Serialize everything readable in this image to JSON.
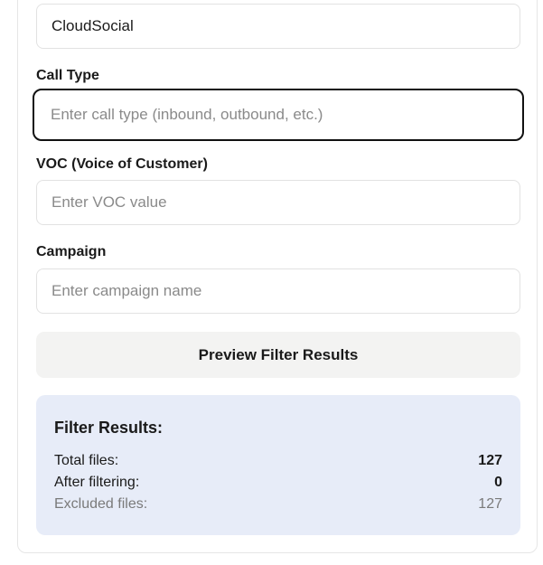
{
  "fields": {
    "source": {
      "value": "CloudSocial"
    },
    "call_type": {
      "label": "Call Type",
      "placeholder": "Enter call type (inbound, outbound, etc.)"
    },
    "voc": {
      "label": "VOC (Voice of Customer)",
      "placeholder": "Enter VOC value"
    },
    "campaign": {
      "label": "Campaign",
      "placeholder": "Enter campaign name"
    }
  },
  "preview_button": {
    "label": "Preview Filter Results"
  },
  "results": {
    "title": "Filter Results:",
    "rows": [
      {
        "label": "Total files:",
        "value": "127"
      },
      {
        "label": "After filtering:",
        "value": "0"
      },
      {
        "label": "Excluded files:",
        "value": "127"
      }
    ]
  },
  "colors": {
    "results_bg": "#e7ecf8",
    "button_bg": "#f3f3f2",
    "focus_border": "#111111"
  }
}
